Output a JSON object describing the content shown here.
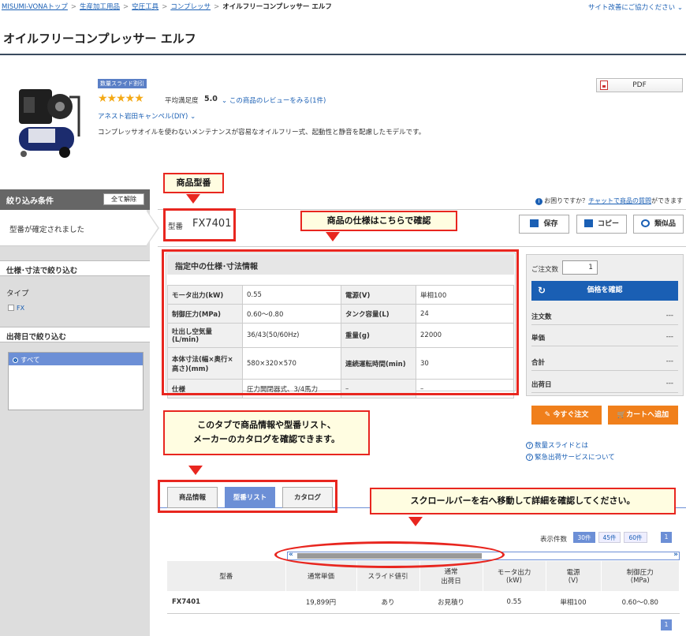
{
  "breadcrumb": {
    "items": [
      "MISUMI-VONAトップ",
      "生産加工用品",
      "空圧工具",
      "コンプレッサ"
    ],
    "current": "オイルフリーコンプレッサー エルフ"
  },
  "survey_link": "サイト改善にご協力ください",
  "title": "オイルフリーコンプレッサー エルフ",
  "product": {
    "badge": "数量スライド割引",
    "stars": "★★★★★",
    "rating_label": "平均満足度",
    "rating": "5.0",
    "review_link": "この商品のレビューをみる(1件)",
    "campaign": "アネスト岩田キャンペル(DIY)",
    "description": "コンプレッサオイルを使わないメンテナンスが容易なオイルフリー式、起動性と静音を配慮したモデルです。",
    "pdf_label": "PDF"
  },
  "sidebar": {
    "header": "絞り込み条件",
    "clear_all": "全て解除",
    "confirmed": "型番が確定されました",
    "section_model": "仕様･寸法で絞り込む",
    "type_label": "タイプ",
    "type_option": "FX",
    "section_ship": "出荷日で絞り込む",
    "ship_option": "すべて"
  },
  "help": {
    "prefix": "お困りですか？",
    "link": "チャットで商品の質問",
    "suffix": "ができます"
  },
  "model": {
    "label": "型番",
    "value": "FX7401"
  },
  "toolbar": {
    "save": "保存",
    "copy": "コピー",
    "similar": "類似品"
  },
  "spec": {
    "header": "指定中の仕様･寸法情報",
    "rows": [
      [
        "モータ出力(kW)",
        "0.55",
        "電源(V)",
        "単相100"
      ],
      [
        "制御圧力(MPa)",
        "0.60～0.80",
        "タンク容量(L)",
        "24"
      ],
      [
        "吐出し空気量(L/min)",
        "36/43(50/60Hz)",
        "重量(g)",
        "22000"
      ],
      [
        "本体寸法(幅×奥行×高さ)(mm)",
        "580×320×570",
        "連続運転時間(min)",
        "30"
      ],
      [
        "仕様",
        "圧力開閉器式、3/4馬力",
        "–",
        "–"
      ]
    ]
  },
  "order": {
    "qty_label": "ご注文数",
    "qty": "1",
    "price_button": "価格を確認",
    "lines": [
      {
        "label": "注文数",
        "value": "---"
      },
      {
        "label": "単価",
        "value": "---"
      },
      {
        "label": "合計",
        "value": "---"
      },
      {
        "label": "出荷日",
        "value": "---"
      }
    ],
    "order_now": "今すぐ注文",
    "add_cart": "カートへ追加",
    "links": [
      "数量スライドとは",
      "緊急出荷サービスについて"
    ]
  },
  "tabs": [
    "商品情報",
    "型番リスト",
    "カタログ"
  ],
  "list": {
    "count_label": "表示件数",
    "page_sizes": [
      "30件",
      "45件",
      "60件"
    ],
    "page": "1",
    "scroll_left": "«",
    "scroll_right": "»",
    "headers": [
      "型番",
      "通常単価",
      "スライド値引",
      "通常\n出荷日",
      "モータ出力\n(kW)",
      "電源\n(V)",
      "制御圧力\n(MPa)"
    ],
    "rows": [
      [
        "FX7401",
        "19,899円",
        "あり",
        "お見積り",
        "0.55",
        "単相100",
        "0.60～0.80"
      ]
    ]
  },
  "callouts": {
    "model": "商品型番",
    "spec": "商品の仕様はこちらで確認",
    "tabs_line1": "このタブで商品情報や型番リスト、",
    "tabs_line2": "メーカーのカタログを確認できます。",
    "scroll": "スクロールバーを右へ移動して詳細を確認してください。"
  },
  "colors": {
    "accent_blue": "#1a5fb4",
    "tab_blue": "#6c8fd6",
    "orange": "#f07f1b",
    "annotation_red": "#e8261f",
    "star": "#f4a916"
  }
}
